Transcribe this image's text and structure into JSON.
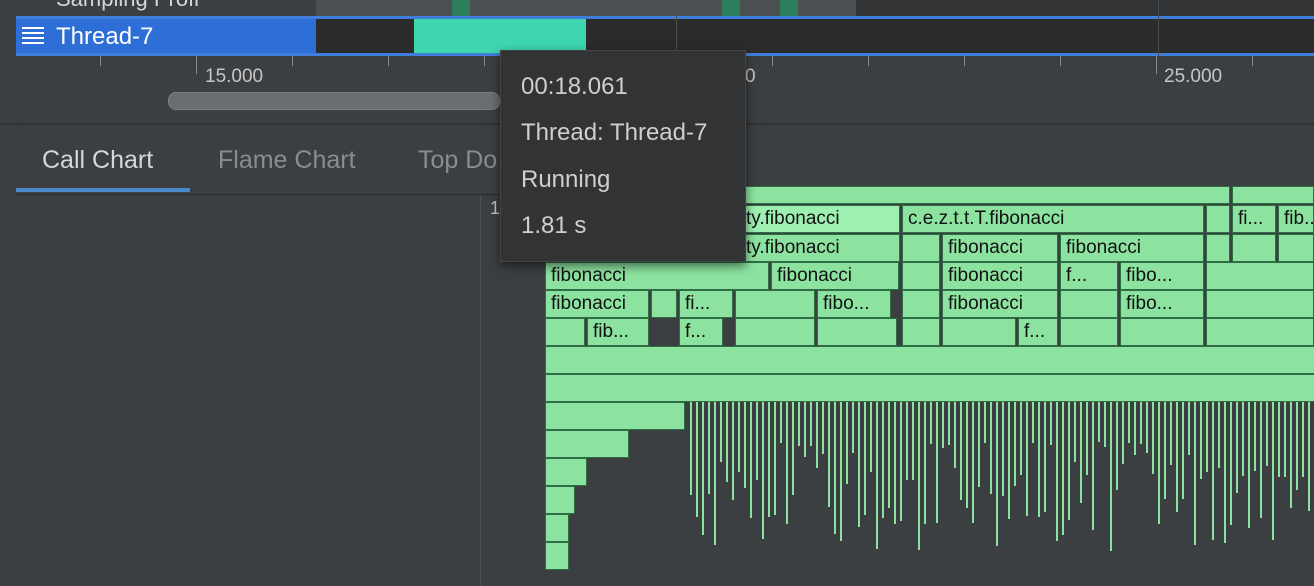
{
  "top_row": {
    "label": "Sampling Profi"
  },
  "thread": {
    "name": "Thread-7",
    "selected_color": "#2d6fd6",
    "running_color": "#3fd6b0"
  },
  "ruler": {
    "labels": [
      {
        "text": "15.000",
        "id": "ruler-label-15000"
      },
      {
        "text": "0",
        "id": "ruler-label-20000-partial"
      },
      {
        "text": "25.000",
        "id": "ruler-label-25000"
      }
    ]
  },
  "tabs": [
    {
      "label": "Call Chart",
      "active": true
    },
    {
      "label": "Flame Chart",
      "active": false
    },
    {
      "label": "Top Do",
      "active": false
    }
  ],
  "chart": {
    "axis_label": "1"
  },
  "frames": {
    "row0_a": "c.e.z.t.t.T.fibonacci",
    "row0_b": "ty.fibonacci",
    "row0_c": "fi...",
    "row0_d": "fib...",
    "row1_a": "ty.fibonacci",
    "row1_b": "fibonacci",
    "row1_c": "fibonacci",
    "row2_a": "fibonacci",
    "row2_b": "fibonacci",
    "row2_c": "fibonacci",
    "row2_d": "f...",
    "row2_e": "fibo...",
    "row3_a": "fibonacci",
    "row3_b": "fi...",
    "row3_c": "fibo...",
    "row3_d": "fibonacci",
    "row3_e": "fibo...",
    "row4_a": "fib...",
    "row4_b": "f...",
    "row4_c": "f..."
  },
  "tooltip": {
    "time": "00:18.061",
    "thread": "Thread: Thread-7",
    "state": "Running",
    "duration": "1.81 s"
  }
}
